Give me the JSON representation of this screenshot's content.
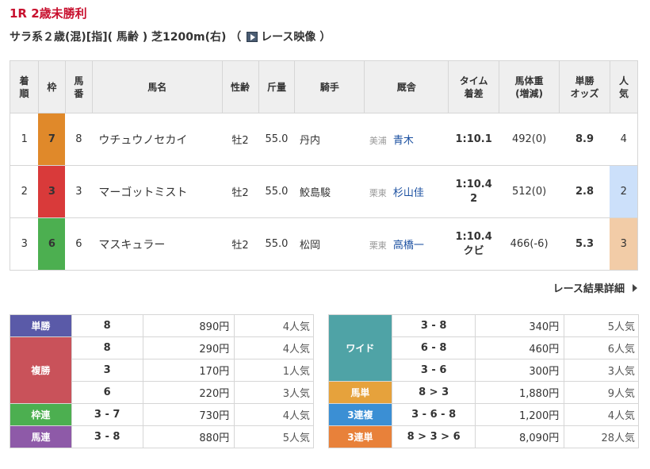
{
  "race": {
    "title": "1R 2歳未勝利",
    "conditions_prefix": "サラ系２歳(混)[指]( 馬齢 ) 芝1200m(右) （",
    "video_label": "レース映像",
    "conditions_suffix": "）"
  },
  "results_table": {
    "headers": {
      "rank": [
        "着",
        "順"
      ],
      "frame": "枠",
      "number": [
        "馬",
        "番"
      ],
      "horse": "馬名",
      "sex_age": "性齢",
      "weight_carried": "斤量",
      "jockey": "騎手",
      "trainer": "厩舎",
      "time": [
        "タイム",
        "着差"
      ],
      "body_weight": [
        "馬体重",
        "(増減)"
      ],
      "odds": [
        "単勝",
        "オッズ"
      ],
      "popularity": [
        "人",
        "気"
      ]
    },
    "rows": [
      {
        "rank": "1",
        "frame": "7",
        "frame_color": "#e0892a",
        "number": "8",
        "horse": "ウチュウノセカイ",
        "sex_age": "牡2",
        "weight_carried": "55.0",
        "jockey": "丹内",
        "region": "美浦",
        "trainer": "青木",
        "time": "1:10.1",
        "margin": "",
        "body_weight": "492(0)",
        "odds": "8.9",
        "popularity": "4",
        "pop_bg": "#ffffff"
      },
      {
        "rank": "2",
        "frame": "3",
        "frame_color": "#d93a3a",
        "number": "3",
        "horse": "マーゴットミスト",
        "sex_age": "牡2",
        "weight_carried": "55.0",
        "jockey": "鮫島駿",
        "region": "栗東",
        "trainer": "杉山佳",
        "time": "1:10.4",
        "margin": "2",
        "body_weight": "512(0)",
        "odds": "2.8",
        "popularity": "2",
        "pop_bg": "#cce0fa"
      },
      {
        "rank": "3",
        "frame": "6",
        "frame_color": "#4caf50",
        "number": "6",
        "horse": "マスキュラー",
        "sex_age": "牡2",
        "weight_carried": "55.0",
        "jockey": "松岡",
        "region": "栗東",
        "trainer": "高橋一",
        "time": "1:10.4",
        "margin": "クビ",
        "body_weight": "466(-6)",
        "odds": "5.3",
        "popularity": "3",
        "pop_bg": "#f2cca7"
      }
    ]
  },
  "details_link": "レース結果詳細",
  "payouts_left": [
    {
      "label": "単勝",
      "color": "#5a5aa8",
      "entries": [
        {
          "combo": "8",
          "amount": "890円",
          "pop": "4人気"
        }
      ]
    },
    {
      "label": "複勝",
      "color": "#c9525a",
      "entries": [
        {
          "combo": "8",
          "amount": "290円",
          "pop": "4人気"
        },
        {
          "combo": "3",
          "amount": "170円",
          "pop": "1人気"
        },
        {
          "combo": "6",
          "amount": "220円",
          "pop": "3人気"
        }
      ]
    },
    {
      "label": "枠連",
      "color": "#4caf50",
      "entries": [
        {
          "combo": "3 - 7",
          "amount": "730円",
          "pop": "4人気"
        }
      ]
    },
    {
      "label": "馬連",
      "color": "#8e5aa8",
      "entries": [
        {
          "combo": "3 - 8",
          "amount": "880円",
          "pop": "5人気"
        }
      ]
    }
  ],
  "payouts_right": [
    {
      "label": "ワイド",
      "color": "#4fa3a6",
      "entries": [
        {
          "combo": "3 - 8",
          "amount": "340円",
          "pop": "5人気"
        },
        {
          "combo": "6 - 8",
          "amount": "460円",
          "pop": "6人気"
        },
        {
          "combo": "3 - 6",
          "amount": "300円",
          "pop": "3人気"
        }
      ]
    },
    {
      "label": "馬単",
      "color": "#e6a23c",
      "entries": [
        {
          "combo": "8 > 3",
          "amount": "1,880円",
          "pop": "9人気"
        }
      ]
    },
    {
      "label": "3連複",
      "color": "#3b8fd4",
      "entries": [
        {
          "combo": "3 - 6 - 8",
          "amount": "1,200円",
          "pop": "4人気"
        }
      ]
    },
    {
      "label": "3連単",
      "color": "#e8813a",
      "entries": [
        {
          "combo": "8 > 3 > 6",
          "amount": "8,090円",
          "pop": "28人気"
        }
      ]
    }
  ]
}
